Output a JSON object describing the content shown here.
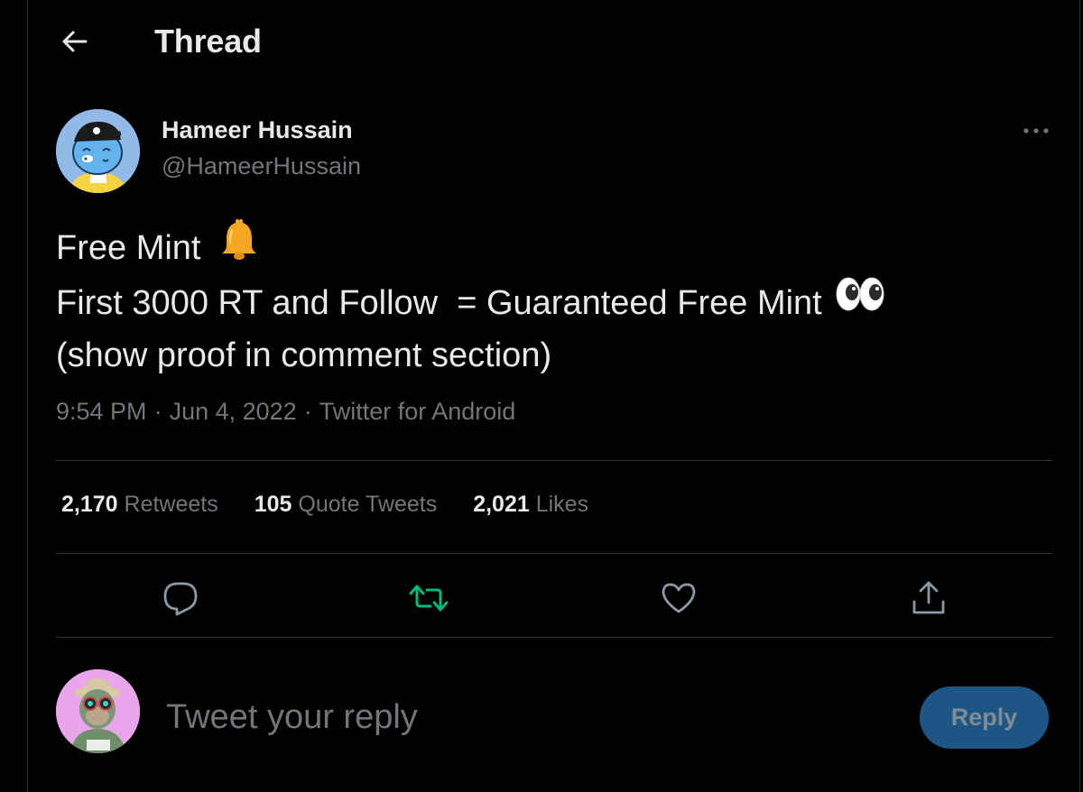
{
  "header": {
    "title": "Thread",
    "back_icon": "arrow-left-icon"
  },
  "author": {
    "name": "Hameer Hussain",
    "handle": "@HameerHussain",
    "more_icon": "more-horizontal-icon"
  },
  "tweet": {
    "lines": [
      "Free Mint ",
      "First 3000 RT and Follow  = Guaranteed Free Mint ",
      "(show proof in comment section)"
    ],
    "emojis": [
      "bell-emoji",
      "eyes-emoji"
    ]
  },
  "meta": {
    "time": "9:54 PM",
    "date": "Jun 4, 2022",
    "source": "Twitter for Android",
    "separator": "·"
  },
  "stats": [
    {
      "count": "2,170",
      "label": "Retweets"
    },
    {
      "count": "105",
      "label": "Quote Tweets"
    },
    {
      "count": "2,021",
      "label": "Likes"
    }
  ],
  "actions": [
    {
      "icon": "reply-icon"
    },
    {
      "icon": "retweet-icon",
      "color": "#00ba7c"
    },
    {
      "icon": "like-icon"
    },
    {
      "icon": "share-icon"
    }
  ],
  "reply": {
    "placeholder": "Tweet your reply",
    "button_label": "Reply"
  },
  "colors": {
    "background": "#000000",
    "text_primary": "#e7e9ea",
    "text_secondary": "#71767b",
    "divider": "#2f3336",
    "retweet_active": "#00ba7c",
    "reply_button_bg": "#1d5684"
  }
}
